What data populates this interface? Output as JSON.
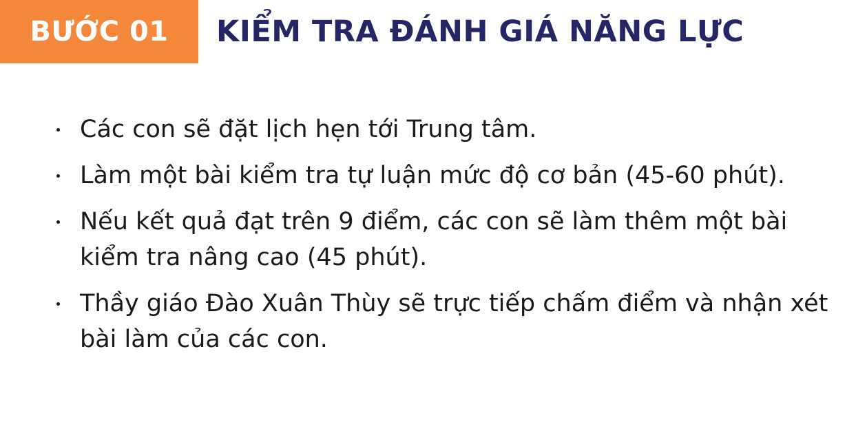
{
  "header": {
    "step_label": "BƯỚC 01",
    "title": "KIỂM TRA ĐÁNH GIÁ NĂNG LỰC"
  },
  "bullets": [
    "Các con sẽ đặt lịch hẹn tới Trung tâm.",
    "Làm một bài kiểm tra tự luận mức độ cơ bản (45-60 phút).",
    "Nếu kết quả đạt trên 9 điểm, các con sẽ làm thêm một bài kiểm tra nâng cao (45 phút).",
    "Thầy giáo Đào Xuân Thùy sẽ trực tiếp chấm điểm và nhận xét bài làm của các con."
  ],
  "colors": {
    "badge_bg": "#f5873a",
    "title": "#262566",
    "body_text": "#1a1a1a"
  },
  "icons": {
    "bullet": "bullet-dot-icon"
  }
}
